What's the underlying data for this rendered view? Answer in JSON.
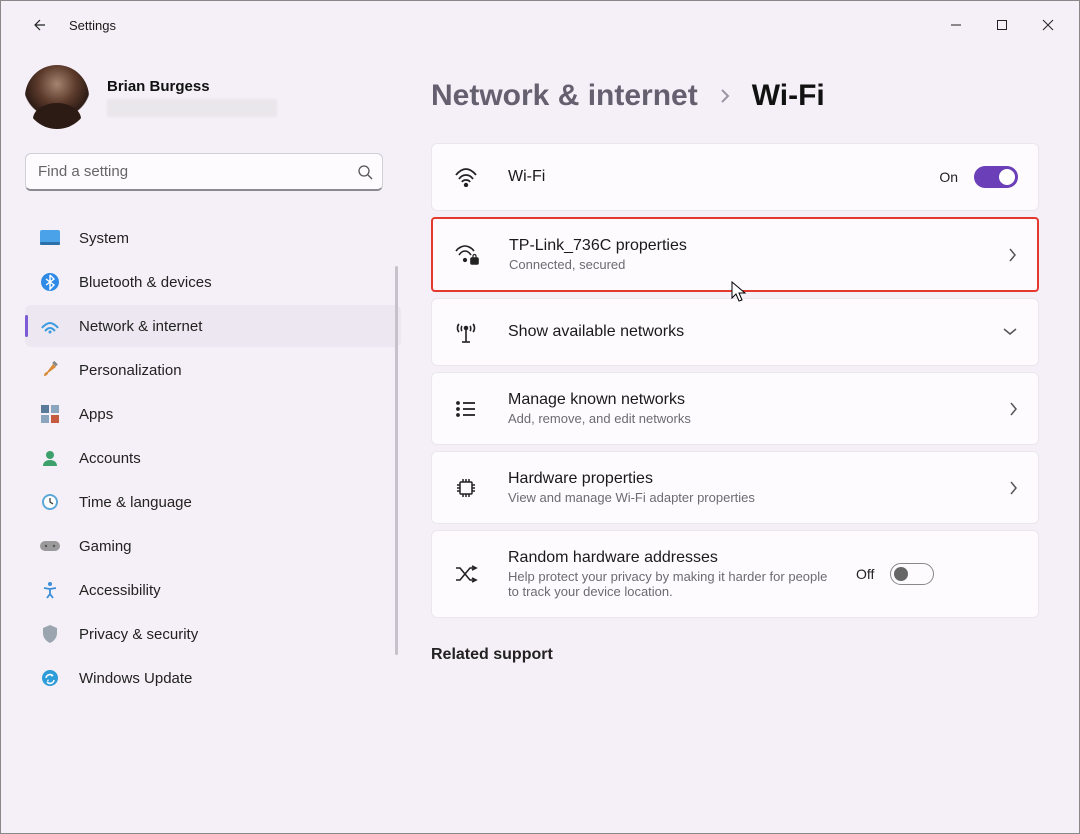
{
  "app": {
    "title": "Settings"
  },
  "profile": {
    "name": "Brian Burgess"
  },
  "search": {
    "placeholder": "Find a setting"
  },
  "sidebar": {
    "items": [
      {
        "label": "System"
      },
      {
        "label": "Bluetooth & devices"
      },
      {
        "label": "Network & internet"
      },
      {
        "label": "Personalization"
      },
      {
        "label": "Apps"
      },
      {
        "label": "Accounts"
      },
      {
        "label": "Time & language"
      },
      {
        "label": "Gaming"
      },
      {
        "label": "Accessibility"
      },
      {
        "label": "Privacy & security"
      },
      {
        "label": "Windows Update"
      }
    ]
  },
  "breadcrumb": {
    "parent": "Network & internet",
    "current": "Wi-Fi"
  },
  "cards": {
    "wifi": {
      "title": "Wi-Fi",
      "state": "On"
    },
    "connected": {
      "title": "TP-Link_736C properties",
      "sub": "Connected, secured"
    },
    "available": {
      "title": "Show available networks"
    },
    "known": {
      "title": "Manage known networks",
      "sub": "Add, remove, and edit networks"
    },
    "hardware": {
      "title": "Hardware properties",
      "sub": "View and manage Wi-Fi adapter properties"
    },
    "random": {
      "title": "Random hardware addresses",
      "sub": "Help protect your privacy by making it harder for people to track your device location.",
      "state": "Off"
    }
  },
  "related": {
    "heading": "Related support"
  }
}
